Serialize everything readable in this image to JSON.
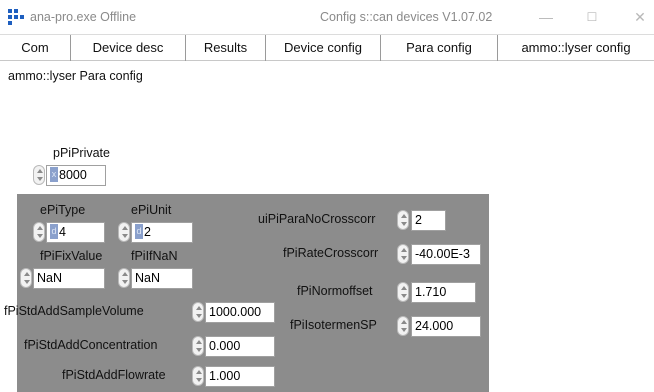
{
  "window": {
    "title_left": "ana-pro.exe  Offline",
    "title_center": "Config s::can devices V1.07.02",
    "minimize": "—",
    "maximize": "☐",
    "close": "✕"
  },
  "tabs": [
    {
      "label": "Com"
    },
    {
      "label": "Device desc"
    },
    {
      "label": "Results"
    },
    {
      "label": "Device config"
    },
    {
      "label": "Para config"
    },
    {
      "label": "ammo::lyser config"
    }
  ],
  "page": {
    "heading": "ammo::lyser Para config"
  },
  "controls": {
    "pPiPrivate": {
      "label": "pPiPrivate",
      "value": "8000",
      "radix": "x"
    },
    "ePiType": {
      "label": "ePiType",
      "value": "4",
      "radix": "d"
    },
    "ePiUnit": {
      "label": "ePiUnit",
      "value": "2",
      "radix": "d"
    },
    "fPiFixValue": {
      "label": "fPiFixValue",
      "value": "NaN"
    },
    "fPiIfNaN": {
      "label": "fPiIfNaN",
      "value": "NaN"
    },
    "fPiStdAddSampleVolume": {
      "label": "fPiStdAddSampleVolume",
      "value": "1000.000"
    },
    "fPiStdAddConcentration": {
      "label": "fPiStdAddConcentration",
      "value": "0.000"
    },
    "fPiStdAddFlowrate": {
      "label": "fPiStdAddFlowrate",
      "value": "1.000"
    },
    "uiPiParaNoCrosscorr": {
      "label": "uiPiParaNoCrosscorr",
      "value": "2"
    },
    "fPiRateCrosscorr": {
      "label": "fPiRateCrosscorr",
      "value": "-40.00E-3"
    },
    "fPiNormoffset": {
      "label": "fPiNormoffset",
      "value": "1.710"
    },
    "fPiIsotermenSP": {
      "label": "fPiIsotermenSP",
      "value": "24.000"
    }
  }
}
